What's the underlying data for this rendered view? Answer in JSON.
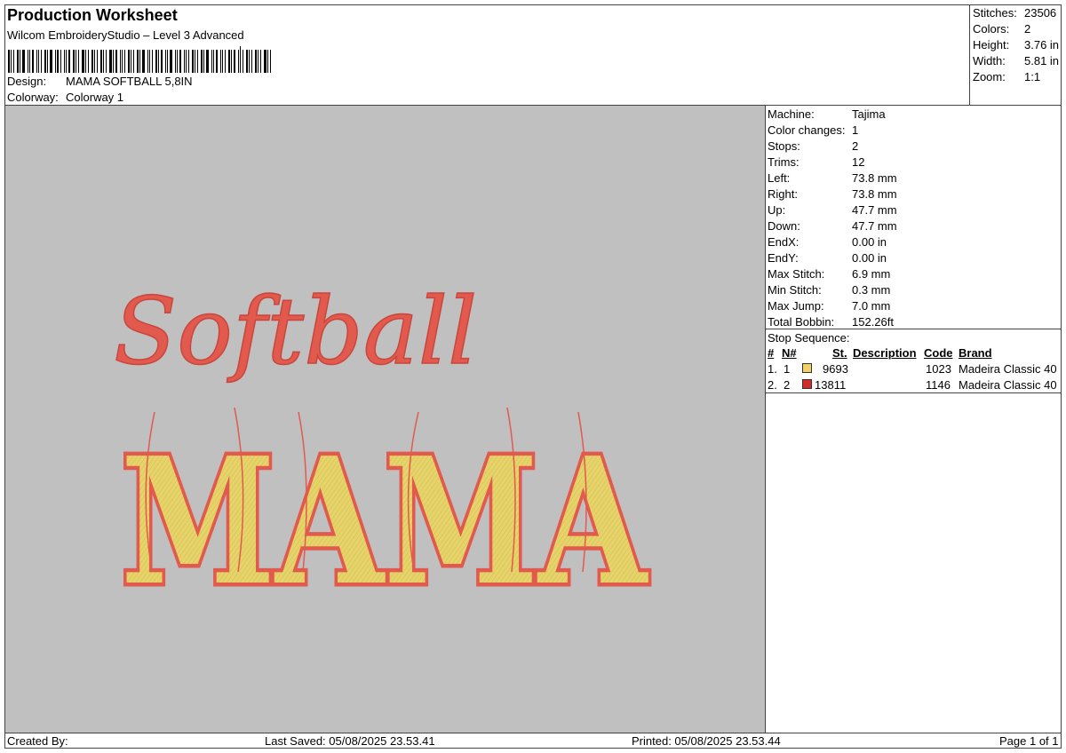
{
  "header": {
    "title": "Production Worksheet",
    "software": "Wilcom EmbroideryStudio – Level 3 Advanced",
    "design_label": "Design:",
    "design_value": "MAMA SOFTBALL 5,8IN",
    "colorway_label": "Colorway:",
    "colorway_value": "Colorway 1"
  },
  "summary": {
    "stitches_label": "Stitches:",
    "stitches_value": "23506",
    "colors_label": "Colors:",
    "colors_value": "2",
    "height_label": "Height:",
    "height_value": "3.76 in",
    "width_label": "Width:",
    "width_value": "5.81 in",
    "zoom_label": "Zoom:",
    "zoom_value": "1:1"
  },
  "details": {
    "machine_label": "Machine:",
    "machine_value": "Tajima",
    "color_changes_label": "Color changes:",
    "color_changes_value": "1",
    "stops_label": "Stops:",
    "stops_value": "2",
    "trims_label": "Trims:",
    "trims_value": "12",
    "left_label": "Left:",
    "left_value": "73.8 mm",
    "right_label": "Right:",
    "right_value": "73.8 mm",
    "up_label": "Up:",
    "up_value": "47.7 mm",
    "down_label": "Down:",
    "down_value": "47.7 mm",
    "endx_label": "EndX:",
    "endx_value": "0.00 in",
    "endy_label": "EndY:",
    "endy_value": "0.00 in",
    "max_stitch_label": "Max Stitch:",
    "max_stitch_value": "6.9 mm",
    "min_stitch_label": "Min Stitch:",
    "min_stitch_value": "0.3 mm",
    "max_jump_label": "Max Jump:",
    "max_jump_value": "7.0 mm",
    "total_bobbin_label": "Total Bobbin:",
    "total_bobbin_value": "152.26ft"
  },
  "stop_sequence": {
    "title": "Stop Sequence:",
    "columns": {
      "num": "#",
      "n": "N#",
      "st": "St.",
      "description": "Description",
      "code": "Code",
      "brand": "Brand"
    },
    "rows": [
      {
        "num": "1.",
        "n": "1",
        "color": "#f4d167",
        "st": "9693",
        "code": "1023",
        "brand": "Madeira Classic 40"
      },
      {
        "num": "2.",
        "n": "2",
        "color": "#d42a2a",
        "st": "13811",
        "code": "1146",
        "brand": "Madeira Classic 40"
      }
    ]
  },
  "design_preview": {
    "script_text": "Softball",
    "block_text": "MAMA",
    "fill_color": "#e6d46a",
    "outline_color": "#e25a4e",
    "background": "#c0c0c0"
  },
  "footer": {
    "created_by": "Created By:",
    "last_saved": "Last Saved: 05/08/2025 23.53.41",
    "printed": "Printed: 05/08/2025 23.53.44",
    "page": "Page 1 of 1"
  }
}
